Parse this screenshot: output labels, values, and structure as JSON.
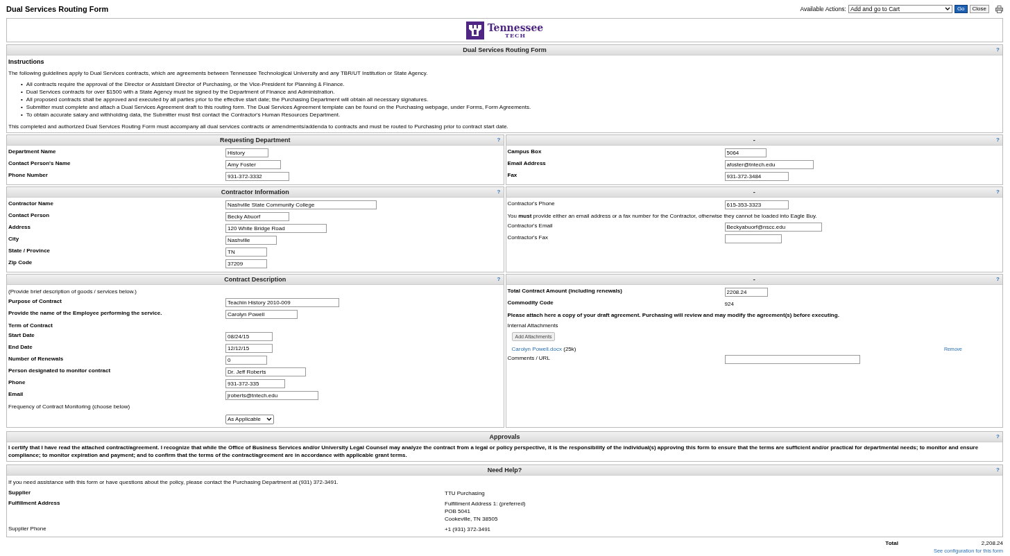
{
  "header": {
    "title": "Dual Services Routing Form",
    "actions_label": "Available Actions:",
    "action": "Add and go to Cart",
    "go": "Go",
    "close": "Close"
  },
  "logo": {
    "name": "Tennessee",
    "sub": "TECH"
  },
  "intro": {
    "title": "Dual Services Routing Form",
    "help": "?",
    "heading": "Instructions",
    "lead": "The following guidelines apply to Dual Services contracts, which are agreements between Tennessee Technological University and any TBR/UT Institution or State Agency.",
    "bullets": [
      {
        "marker": "•",
        "text": "All contracts require the approval of the Director or Assistant Director of Purchasing, or the Vice-President for Planning & Finance."
      },
      {
        "marker": "•",
        "text": "Dual Services contracts for over $1500 with a State Agency must be signed by the Department of Finance and Administration."
      },
      {
        "marker": "•",
        "text": "All proposed contracts shall be approved and executed by all parties prior to the effective start date; the Purchasing Department will obtain all necessary signatures."
      },
      {
        "marker": "•",
        "text": "Submitter must complete and attach a Dual Services Agreement draft to this routing form. The Dual Services Agreement template can be found on the Purchasing webpage, under Forms, Form Agreements."
      },
      {
        "marker": "•",
        "text": "To obtain accurate salary and withholding data, the Submitter must first contact the Contractor's Human Resources Department."
      }
    ],
    "closing": "This completed and authorized Dual Services Routing Form must accompany all dual services contracts or amendments/addenda to contracts and must be routed to Purchasing prior to contract start date."
  },
  "rows": [
    {
      "left": {
        "title": "Requesting Department",
        "help": "?",
        "fields": [
          {
            "kind": "input",
            "label": "Department Name",
            "bold": true,
            "value": "History"
          },
          {
            "kind": "input",
            "label": "Contact Person's Name",
            "bold": true,
            "value": "Amy Foster"
          },
          {
            "kind": "input",
            "label": "Phone Number",
            "bold": true,
            "value": "931-372-3332"
          }
        ]
      },
      "right": {
        "title": "-",
        "help": "?",
        "fields": [
          {
            "kind": "input",
            "label": "Campus Box",
            "bold": true,
            "value": "5064"
          },
          {
            "kind": "input",
            "label": "Email Address",
            "bold": true,
            "value": "afoster@tntech.edu"
          },
          {
            "kind": "input",
            "label": "Fax",
            "bold": true,
            "value": "931-372-3484"
          }
        ]
      }
    },
    {
      "left": {
        "title": "Contractor Information",
        "help": "?",
        "fields": [
          {
            "kind": "input",
            "label": "Contractor Name",
            "bold": true,
            "value": "Nashville State Community College"
          },
          {
            "kind": "input",
            "label": "Contact Person",
            "bold": true,
            "value": "Becky Abuorf"
          },
          {
            "kind": "input",
            "label": "Address",
            "bold": true,
            "value": "120 White Bridge Road"
          },
          {
            "kind": "input",
            "label": "City",
            "bold": true,
            "value": "Nashville"
          },
          {
            "kind": "input",
            "label": "State / Province",
            "bold": true,
            "value": "TN"
          },
          {
            "kind": "input",
            "label": "Zip Code",
            "bold": true,
            "value": "37209"
          }
        ]
      },
      "right": {
        "title": "-",
        "help": "?",
        "fields": [
          {
            "kind": "input",
            "label": "Contractor's Phone",
            "bold": false,
            "value": "615-353-3323"
          },
          {
            "kind": "note",
            "text": "You **must** provide either an email address or a fax number for the Contractor, otherwise they cannot be loaded into Eagle Buy.",
            "bold": false
          },
          {
            "kind": "input",
            "label": "Contractor's Email",
            "bold": false,
            "value": "Beckyabuorf@nscc.edu"
          },
          {
            "kind": "input",
            "label": "Contractor's Fax",
            "bold": false
          }
        ]
      }
    },
    {
      "left": {
        "title": "Contract Description",
        "help": "?",
        "fields": [
          {
            "kind": "note",
            "text": "(Provide brief description of goods / services below.)",
            "bold": false
          },
          {
            "kind": "input",
            "label": "Purpose of Contract",
            "bold": true,
            "value": "Teachin History 2010-009"
          },
          {
            "kind": "input",
            "label": "Provide the name of the Employee performing the service.",
            "bold": true,
            "value": "Carolyn Powell"
          },
          {
            "kind": "note",
            "text": "Term of Contract",
            "bold": true
          },
          {
            "kind": "input",
            "label": "Start Date",
            "bold": true,
            "value": "08/24/15"
          },
          {
            "kind": "input",
            "label": "End Date",
            "bold": true,
            "value": "12/12/15"
          },
          {
            "kind": "input",
            "label": "Number of Renewals",
            "bold": true,
            "value": "0"
          },
          {
            "kind": "input",
            "label": "Person designated to monitor contract",
            "bold": true,
            "value": "Dr. Jeff Roberts"
          },
          {
            "kind": "input",
            "label": "Phone",
            "bold": true,
            "value": "931-372-335"
          },
          {
            "kind": "input",
            "label": "Email",
            "bold": true,
            "value": "jroberts@tntech.edu"
          },
          {
            "kind": "note",
            "text": "Frequency of Contract Monitoring (choose below)",
            "bold": false
          },
          {
            "kind": "select",
            "value": "As Applicable"
          }
        ]
      },
      "right": {
        "title": "-",
        "help": "?",
        "fields": [
          {
            "kind": "input",
            "label": "Total Contract Amount (including renewals)",
            "bold": true,
            "value": "2208.24"
          },
          {
            "kind": "static",
            "label": "Commodity Code",
            "bold": true,
            "value": "924"
          },
          {
            "kind": "note",
            "text": "Please attach here a copy of your draft agreement. Purchasing will review and may modify the agreement(s) before executing.",
            "bold": true
          },
          {
            "kind": "note",
            "text": "Internal Attachments",
            "bold": false
          },
          {
            "kind": "attachments",
            "button": "Add Attachments",
            "file": "Carolyn Powell.docx",
            "size": "(25k)",
            "remove": "Remove"
          },
          {
            "kind": "input",
            "label": "Comments / URL",
            "bold": false
          }
        ]
      }
    }
  ],
  "approvals": {
    "title": "Approvals",
    "help": "?",
    "text": "I certify that I have read the attached contract/agreement. I recognize that while the Office of Business Services and/or University Legal Counsel may analyze the contract from a legal or policy perspective, it is the responsibility of the individual(s) approving this form to ensure that the terms are sufficient and/or practical for departmental needs; to monitor and ensure compliance; to monitor expiration and payment; and to confirm that the terms of the contract/agreement are in accordance with applicable grant terms."
  },
  "help": {
    "title": "Need Help?",
    "help": "?",
    "text": "If you need assistance with this form or have questions about the policy, please contact the Purchasing Department at (931) 372-3491.",
    "rows": [
      {
        "label": "Supplier",
        "bold": true,
        "lines": [
          "TTU Purchasing"
        ]
      },
      {
        "label": "Fulfillment Address",
        "bold": true,
        "lines": [
          "Fulfillment Address 1: (preferred)",
          "POB 5041",
          "Cookeville, TN 38505"
        ]
      },
      {
        "label": "Supplier Phone",
        "bold": false,
        "lines": [
          "+1 (931) 372-3491"
        ]
      }
    ]
  },
  "footer": {
    "total_label": "Total",
    "total": "2,208.24",
    "config_link": "See configuration for this form"
  }
}
